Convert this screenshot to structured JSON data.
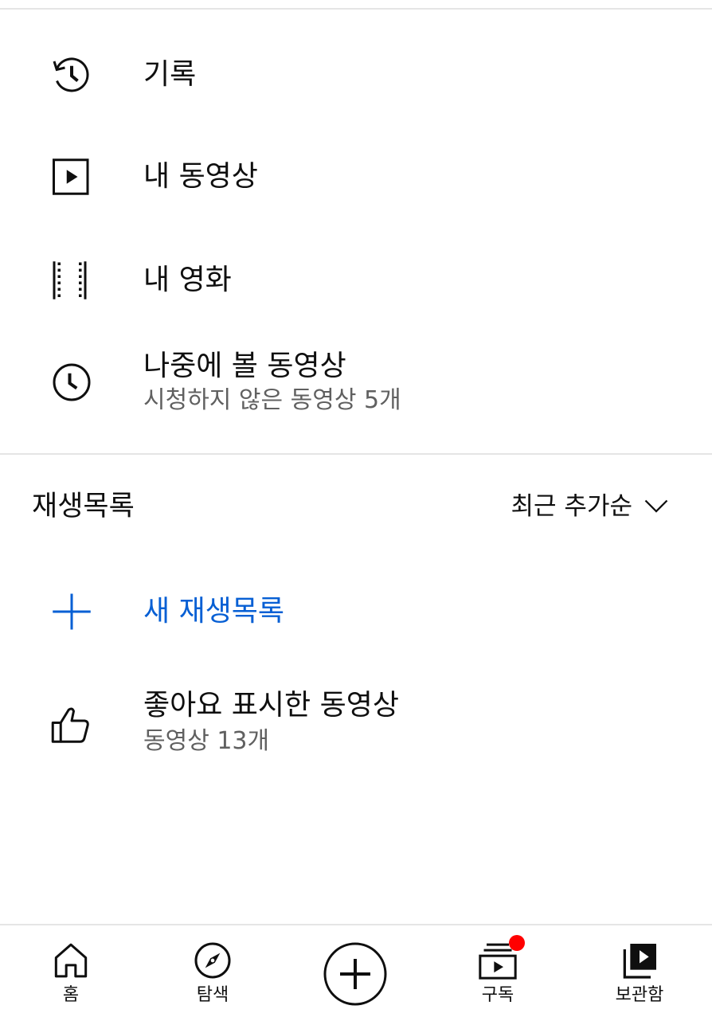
{
  "library": {
    "items": [
      {
        "label": "기록",
        "icon": "history-icon"
      },
      {
        "label": "내 동영상",
        "icon": "play-square-icon"
      },
      {
        "label": "내 영화",
        "icon": "film-icon"
      },
      {
        "label": "나중에 볼 동영상",
        "sub": "시청하지 않은 동영상 5개",
        "icon": "clock-icon"
      }
    ]
  },
  "playlists": {
    "title": "재생목록",
    "sort_label": "최근 추가순",
    "new_label": "새 재생목록",
    "liked": {
      "label": "좋아요 표시한 동영상",
      "sub": "동영상 13개"
    }
  },
  "bottom_nav": {
    "home": "홈",
    "explore": "탐색",
    "subscriptions": "구독",
    "library": "보관함"
  },
  "colors": {
    "accent_blue": "#065fd4",
    "badge_red": "#ff0000",
    "text": "#0f0f0f",
    "secondary_text": "#606060"
  }
}
